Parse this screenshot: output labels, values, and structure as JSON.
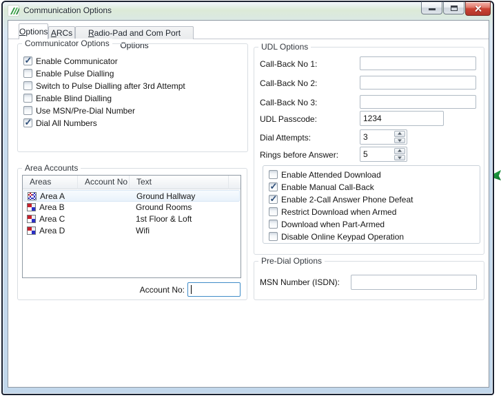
{
  "window": {
    "title": "Communication Options",
    "icons": {
      "app": "green-stripes-icon",
      "minimize": "minimize-icon",
      "maximize": "maximize-icon",
      "close": "close-icon"
    }
  },
  "colors": {
    "close_button_red": "#c0392b",
    "glass_border_blue": "#c7dbee",
    "app_icon_green": "#2f9e3f",
    "area_icon_red": "#c8202c",
    "area_icon_blue": "#2b2fc4",
    "focus_border_blue": "#3e8bc8",
    "selected_row": "#eef5fc"
  },
  "tabs": [
    {
      "label": "Options",
      "active": true
    },
    {
      "label": "ARCs",
      "active": false
    },
    {
      "label": "Radio-Pad and Com Port Options",
      "active": false
    }
  ],
  "communicator_options": {
    "title": "Communicator Options",
    "checkboxes": [
      {
        "label": "Enable Communicator",
        "checked": true
      },
      {
        "label": "Enable Pulse Dialling",
        "checked": false
      },
      {
        "label": "Switch to Pulse Dialling after 3rd Attempt",
        "checked": false
      },
      {
        "label": "Enable Blind Dialling",
        "checked": false
      },
      {
        "label": "Use MSN/Pre-Dial Number",
        "checked": false
      },
      {
        "label": "Dial All Numbers",
        "checked": true
      }
    ]
  },
  "area_accounts": {
    "title": "Area Accounts",
    "columns": [
      "Areas",
      "Account No",
      "Text"
    ],
    "rows": [
      {
        "area": "Area A",
        "account_no": "",
        "text": "Ground Hallway",
        "selected": true
      },
      {
        "area": "Area B",
        "account_no": "",
        "text": "Ground Rooms",
        "selected": false
      },
      {
        "area": "Area C",
        "account_no": "",
        "text": "1st Floor & Loft",
        "selected": false
      },
      {
        "area": "Area D",
        "account_no": "",
        "text": "Wifi",
        "selected": false
      }
    ],
    "account_no_label": "Account No:",
    "account_no_value": ""
  },
  "udl_options": {
    "title": "UDL Options",
    "fields": [
      {
        "label": "Call-Back No 1:",
        "value": ""
      },
      {
        "label": "Call-Back No 2:",
        "value": ""
      },
      {
        "label": "Call-Back No 3:",
        "value": ""
      },
      {
        "label": "UDL Passcode:",
        "value": "1234"
      },
      {
        "label": "Dial Attempts:",
        "value": "3"
      },
      {
        "label": "Rings before Answer:",
        "value": "5"
      }
    ],
    "checkboxes": [
      {
        "label": "Enable Attended Download",
        "checked": false
      },
      {
        "label": "Enable Manual Call-Back",
        "checked": true
      },
      {
        "label": "Enable 2-Call Answer Phone Defeat",
        "checked": true
      },
      {
        "label": "Restrict Download when Armed",
        "checked": false
      },
      {
        "label": "Download when Part-Armed",
        "checked": false
      },
      {
        "label": "Disable Online Keypad Operation",
        "checked": false
      }
    ]
  },
  "pre_dial_options": {
    "title": "Pre-Dial Options",
    "msn_label": "MSN Number (ISDN):",
    "msn_value": ""
  }
}
